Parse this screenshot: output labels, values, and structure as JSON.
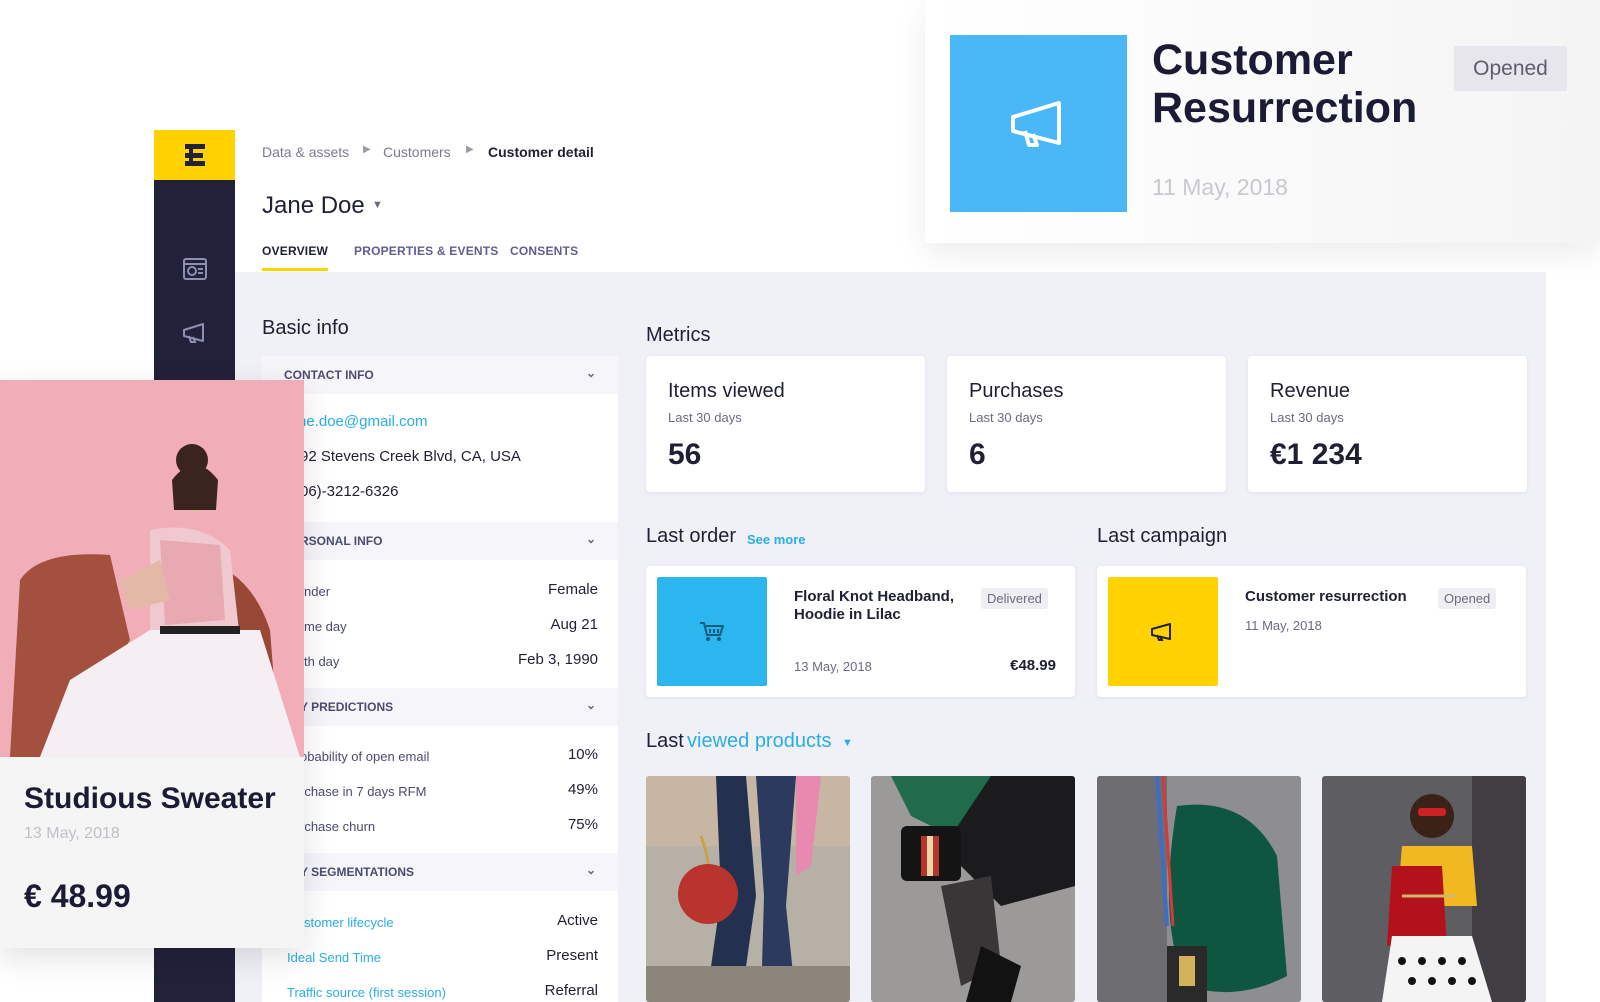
{
  "breadcrumb": {
    "items": [
      "Data & assets",
      "Customers"
    ],
    "current": "Customer detail"
  },
  "customer": {
    "name": "Jane Doe"
  },
  "tabs": [
    {
      "label": "OVERVIEW"
    },
    {
      "label": "PROPERTIES & EVENTS"
    },
    {
      "label": "CONSENTS"
    }
  ],
  "basic_info": {
    "title": "Basic info",
    "contact": {
      "header": "CONTACT INFO",
      "email": "ne.doe@gmail.com",
      "address": "92 Stevens Creek Blvd, CA, USA",
      "phone": "06)-3212-6326"
    },
    "personal": {
      "header": "RSONAL INFO",
      "rows": [
        {
          "key": "nder",
          "value": "Female"
        },
        {
          "key": "me day",
          "value": "Aug 21"
        },
        {
          "key": "th day",
          "value": "Feb 3, 1990"
        }
      ]
    },
    "predictions": {
      "header": "Y PREDICTIONS",
      "rows": [
        {
          "key": "obability of open email",
          "value": "10%"
        },
        {
          "key": "rchase in 7 days RFM",
          "value": "49%"
        },
        {
          "key": "rchase churn",
          "value": "75%"
        }
      ]
    },
    "segmentations": {
      "header": "Y SEGMENTATIONS",
      "rows": [
        {
          "key": "stomer lifecycle",
          "value": "Active"
        },
        {
          "key": "Ideal Send Time",
          "value": "Present"
        },
        {
          "key": "Traffic source (first session)",
          "value": "Referral"
        }
      ]
    }
  },
  "metrics": {
    "title": "Metrics",
    "cards": [
      {
        "title": "Items viewed",
        "sub": "Last 30 days",
        "value": "56"
      },
      {
        "title": "Purchases",
        "sub": "Last 30 days",
        "value": "6"
      },
      {
        "title": "Revenue",
        "sub": "Last 30 days",
        "value": "€1 234"
      }
    ]
  },
  "last_order": {
    "title": "Last order",
    "see_more": "See more",
    "product": "Floral Knot Headband, Hoodie in Lilac",
    "status": "Delivered",
    "date": "13 May, 2018",
    "price": "€48.99",
    "tile_color": "#2bb6ef"
  },
  "last_campaign": {
    "title": "Last campaign",
    "name": "Customer resurrection",
    "status": "Opened",
    "date": "11 May, 2018",
    "tile_color": "#ffd200"
  },
  "last_viewed": {
    "prefix": "Last",
    "highlight": "viewed products"
  },
  "overlay_campaign": {
    "title": "Customer Resurrection",
    "date": "11 May, 2018",
    "status": "Opened",
    "tile_color": "#4ab7f7"
  },
  "overlay_product": {
    "name": "Studious Sweater",
    "date": "13 May, 2018",
    "price": "€ 48.99"
  },
  "icons": {
    "logo": "logo-icon",
    "dashboard": "dashboard-icon",
    "campaigns": "megaphone-icon",
    "cart": "cart-icon"
  },
  "colors": {
    "accent_yellow": "#ffd200",
    "sidebar": "#22213a",
    "link_blue": "#29aee3",
    "tab_inactive": "#5d5f92"
  }
}
